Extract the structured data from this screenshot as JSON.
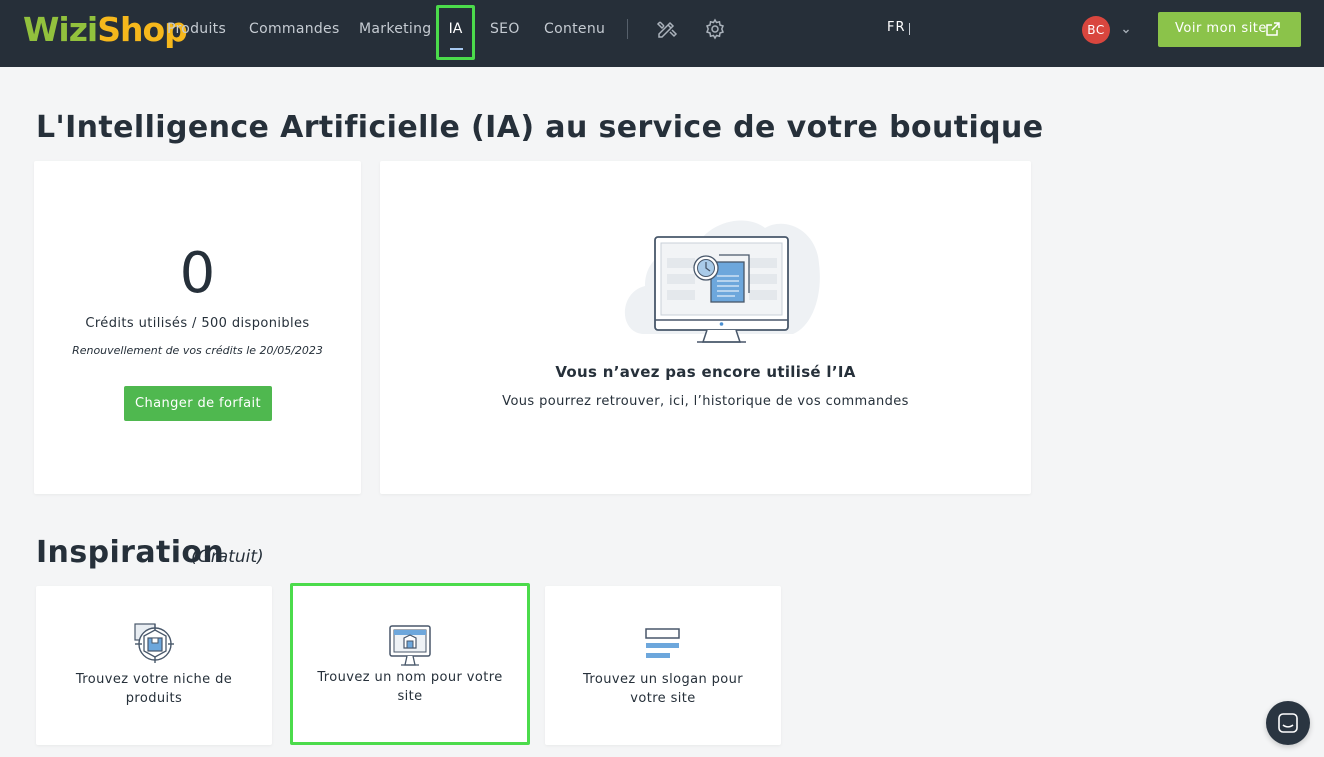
{
  "header": {
    "logo_part1": "Wizi",
    "logo_part2": "Shop",
    "nav": [
      {
        "label": "Produits"
      },
      {
        "label": "Commandes"
      },
      {
        "label": "Marketing"
      },
      {
        "label": "IA",
        "active": true
      },
      {
        "label": "SEO"
      },
      {
        "label": "Contenu"
      }
    ],
    "icons": [
      "design-tools-icon",
      "settings-gear-icon"
    ],
    "language": "FR",
    "user_initials": "BC",
    "visit_site_label": "Voir mon site",
    "colors": {
      "bar": "#262f39",
      "visit_button": "#8bc34a",
      "avatar": "#d9463e",
      "active_highlight": "#4bdb4b"
    }
  },
  "main": {
    "title": "L'Intelligence Artificielle (IA) au service de votre boutique",
    "credits": {
      "used": "0",
      "summary": "Crédits utilisés / 500 disponibles",
      "renewal": "Renouvellement de vos crédits le 20/05/2023",
      "change_plan_label": "Changer de forfait",
      "button_color": "#4fb84f"
    },
    "history": {
      "empty_title": "Vous n’avez pas encore utilisé l’IA",
      "empty_subtitle": "Vous pourrez retrouver, ici, l’historique de vos commandes",
      "illustration": "monitor-history-illustration"
    }
  },
  "inspiration": {
    "title": "Inspiration",
    "note": "(Gratuit)",
    "tools": [
      {
        "label": "Trouvez votre niche de produits",
        "icon": "product-target-icon"
      },
      {
        "label": "Trouvez un nom pour votre site",
        "icon": "monitor-store-icon",
        "highlighted": true
      },
      {
        "label": "Trouvez un slogan pour votre site",
        "icon": "text-lines-icon"
      }
    ]
  },
  "chat": {
    "icon": "chat-messenger-icon"
  }
}
